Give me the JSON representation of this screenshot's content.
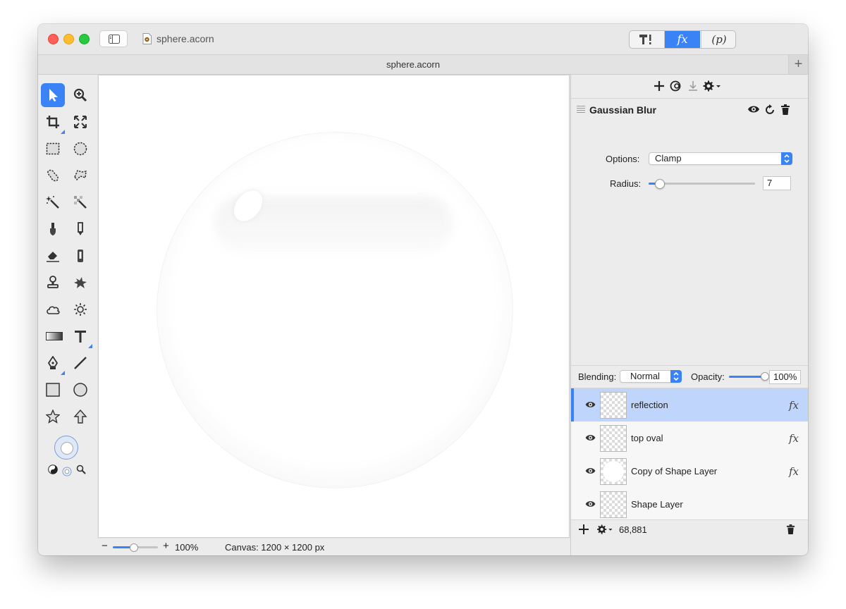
{
  "window": {
    "title": "sphere.acorn",
    "tab_title": "sphere.acorn"
  },
  "toolbar": {
    "segments": [
      "tools",
      "fx",
      "p"
    ],
    "fx_label": "fx",
    "p_label": "(p)",
    "new_tab": "+"
  },
  "tools": [
    "select-arrow",
    "zoom",
    "crop",
    "transform",
    "rect-select",
    "ellipse-select",
    "lasso",
    "polygon-lasso",
    "magic-wand",
    "color-select",
    "brush",
    "pencil",
    "eraser",
    "clone",
    "stamp",
    "smudge",
    "cloud",
    "sun",
    "gradient",
    "text",
    "pen",
    "line",
    "rectangle",
    "ellipse",
    "star",
    "arrow"
  ],
  "filter": {
    "name": "Gaussian Blur",
    "options_label": "Options:",
    "options_value": "Clamp",
    "radius_label": "Radius:",
    "radius_value": "7",
    "radius_fraction": 0.1
  },
  "blending": {
    "label": "Blending:",
    "mode": "Normal",
    "opacity_label": "Opacity:",
    "opacity_value": "100%",
    "opacity_fraction": 1.0
  },
  "layers": [
    {
      "name": "reflection",
      "fx": "fx",
      "selected": true
    },
    {
      "name": "top oval",
      "fx": "fx",
      "selected": false
    },
    {
      "name": "Copy of Shape Layer",
      "fx": "fx",
      "selected": false
    },
    {
      "name": "Shape Layer",
      "fx": "",
      "selected": false
    }
  ],
  "layers_footer": {
    "count": "68,881"
  },
  "status": {
    "zoom": "100%",
    "canvas_info": "Canvas: 1200 × 1200 px",
    "zoom_fraction": 0.45
  },
  "colors": {
    "accent": "#3a83f7",
    "selection": "#bfd5fb"
  }
}
